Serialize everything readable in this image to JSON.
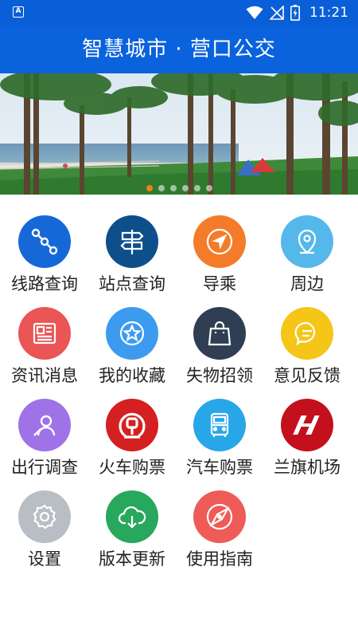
{
  "status_bar": {
    "time": "11:21",
    "icons": [
      "app-badge-icon",
      "wifi-icon",
      "no-signal-icon",
      "battery-charging-icon"
    ]
  },
  "header": {
    "title": "智慧城市 · 营口公交"
  },
  "banner": {
    "slides": 6,
    "active_slide": 0,
    "accent": "#f27d1a"
  },
  "menu": {
    "items": [
      {
        "label": "线路查询",
        "icon": "route-icon",
        "color": "#1668d9"
      },
      {
        "label": "站点查询",
        "icon": "signpost-icon",
        "color": "#0d4f8b"
      },
      {
        "label": "导乘",
        "icon": "navigation-arrow-icon",
        "color": "#f47b2a"
      },
      {
        "label": "周边",
        "icon": "location-pin-icon",
        "color": "#55b8ea"
      },
      {
        "label": "资讯消息",
        "icon": "newspaper-icon",
        "color": "#ea5556"
      },
      {
        "label": "我的收藏",
        "icon": "star-icon",
        "color": "#3c9bef"
      },
      {
        "label": "失物招领",
        "icon": "shopping-bag-icon",
        "color": "#2f3e52"
      },
      {
        "label": "意见反馈",
        "icon": "chat-bubble-icon",
        "color": "#f5c518"
      },
      {
        "label": "出行调查",
        "icon": "survey-person-icon",
        "color": "#9f72e8"
      },
      {
        "label": "火车购票",
        "icon": "railway-logo-icon",
        "color": "#d42020"
      },
      {
        "label": "汽车购票",
        "icon": "bus-icon",
        "color": "#28a7e8"
      },
      {
        "label": "兰旗机场",
        "icon": "airport-logo-icon",
        "color": "#c3101c"
      },
      {
        "label": "设置",
        "icon": "gear-icon",
        "color": "#b9bec4"
      },
      {
        "label": "版本更新",
        "icon": "cloud-download-icon",
        "color": "#27a85c"
      },
      {
        "label": "使用指南",
        "icon": "compass-icon",
        "color": "#ef5b57"
      }
    ]
  }
}
